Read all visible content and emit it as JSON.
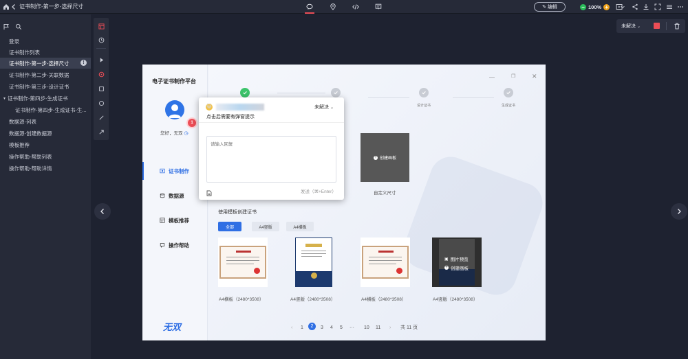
{
  "topbar": {
    "breadcrumb": "证书制作-第一步-选择尺寸",
    "edit_label": "编辑",
    "zoom": "100%",
    "icons": [
      "home-icon",
      "back-icon",
      "comment-icon",
      "location-icon",
      "code-icon",
      "annotation-icon",
      "share-icon",
      "download-icon",
      "fullscreen-icon",
      "menu-icon",
      "play-icon"
    ]
  },
  "sidebar": {
    "items": [
      {
        "label": "登录"
      },
      {
        "label": "证书制作列表"
      },
      {
        "label": "证书制作-第一步-选择尺寸",
        "active": true
      },
      {
        "label": "证书制作-第二步-关联数据"
      },
      {
        "label": "证书制作-第三步-设计证书"
      },
      {
        "label": "证书制作-第四步-生成证书",
        "expanded": true
      },
      {
        "label": "证书制作-第四步-生成证书-生..."
      },
      {
        "label": "数据源-列表"
      },
      {
        "label": "数据源-创建数据源"
      },
      {
        "label": "模板推荐"
      },
      {
        "label": "操作帮助-帮助列表"
      },
      {
        "label": "操作帮助-帮助详情"
      }
    ]
  },
  "right_toolbar": {
    "status": "未解决"
  },
  "app": {
    "title": "电子证书制作平台",
    "greeting": "您好，无双",
    "menu": [
      {
        "label": "证书制作",
        "active": true
      },
      {
        "label": "数据源"
      },
      {
        "label": "模板推荐"
      },
      {
        "label": "操作帮助"
      }
    ],
    "steps": [
      {
        "label": ""
      },
      {
        "label": ""
      },
      {
        "label": "设计证书"
      },
      {
        "label": "生成证书"
      }
    ],
    "create_board_label": "创建画板",
    "custom_size_label": "自定义尺寸",
    "template_section_title": "使用模板创建证书",
    "filters": [
      {
        "label": "全部",
        "active": true
      },
      {
        "label": "A4竖版"
      },
      {
        "label": "A4横板"
      }
    ],
    "templates": [
      {
        "label": "A4横板（2480*3508）"
      },
      {
        "label": "A4竖版（2480*3508）"
      },
      {
        "label": "A4横板（2480*3508）"
      },
      {
        "label": "A4竖版（2480*3508）"
      }
    ],
    "hover_actions": {
      "preview": "图片预览",
      "create": "创建画板"
    },
    "pagination": {
      "pages": [
        "1",
        "2",
        "3",
        "4",
        "5",
        "···",
        "10",
        "11"
      ],
      "current": "2",
      "total": "共 11 页"
    },
    "logo_text": "无双"
  },
  "comment": {
    "badge_number": "1",
    "status": "未解决",
    "message": "点击后需要有弹窗提示",
    "placeholder": "请输入回复",
    "send_hint": "发送（⌘+Enter）"
  },
  "colors": {
    "accent": "#2f6fe4",
    "badge": "#ec4d56",
    "zoom_green": "#2bbd5a",
    "zoom_orange": "#f2a51c"
  }
}
